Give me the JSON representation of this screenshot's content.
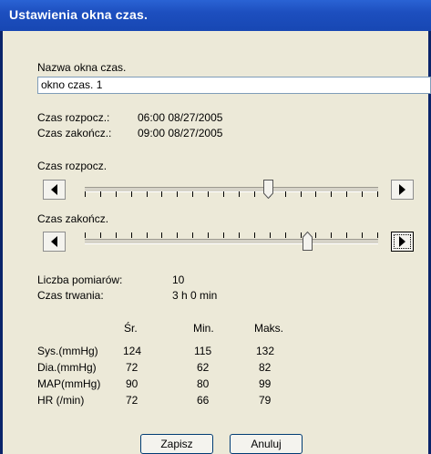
{
  "window": {
    "title": "Ustawienia okna czas."
  },
  "name_section": {
    "label": "Nazwa okna czas.",
    "value": "okno czas. 1"
  },
  "times": {
    "start_label": "Czas rozpocz.:",
    "start_value": "06:00 08/27/2005",
    "end_label": "Czas zakończ.:",
    "end_value": "09:00 08/27/2005"
  },
  "sliders": {
    "start": {
      "label": "Czas rozpocz.",
      "position_fraction": 0.63
    },
    "end": {
      "label": "Czas zakończ.",
      "position_fraction": 0.77
    }
  },
  "summary": {
    "measurements_label": "Liczba pomiarów:",
    "measurements_value": "10",
    "duration_label": "Czas trwania:",
    "duration_value": "3 h 0 min"
  },
  "stats": {
    "headers": [
      "Śr.",
      "Min.",
      "Maks."
    ],
    "rows": [
      {
        "label": "Sys.(mmHg)",
        "avg": "124",
        "min": "115",
        "max": "132"
      },
      {
        "label": "Dia.(mmHg)",
        "avg": "72",
        "min": "62",
        "max": "82"
      },
      {
        "label": "MAP(mmHg)",
        "avg": "90",
        "min": "80",
        "max": "99"
      },
      {
        "label": "HR (/min)",
        "avg": "72",
        "min": "66",
        "max": "79"
      }
    ]
  },
  "buttons": {
    "save": "Zapisz",
    "cancel": "Anuluj"
  },
  "colors": {
    "title_bar": "#1d4fbf",
    "client_bg": "#ece9d8",
    "button_border": "#003c74"
  }
}
